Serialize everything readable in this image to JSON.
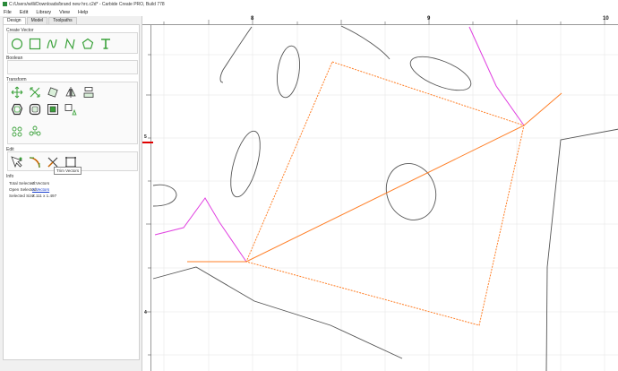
{
  "window": {
    "title": "C:/Users/willi/Downloads/brand new hrc.c2d* - Carbide Create PRO, Build 778"
  },
  "menu": [
    "File",
    "Edit",
    "Library",
    "View",
    "Help"
  ],
  "tabs": [
    "Design",
    "Model",
    "Toolpaths"
  ],
  "sections": {
    "create_vector": "Create Vector",
    "boolean": "Boolean",
    "transform": "Transform",
    "edit": "Edit",
    "info": "Info"
  },
  "tooltip": "Trim Vectors",
  "info": {
    "total_selected_label": "Total Selected:",
    "total_selected_value": "2 Vectors",
    "open_selected_label": "Open Selected:",
    "open_selected_value": "2 Vectors",
    "selected_size_label": "Selected Size:",
    "selected_size_value": "2.111 x 1.497"
  },
  "ruler": {
    "top_labels": [
      "8",
      "9",
      "10"
    ],
    "left_labels": [
      "5",
      "4"
    ]
  },
  "colors": {
    "accent": "#3aa13a",
    "selected": "#ff7f27",
    "magenta": "#e040e0",
    "curve": "#555555",
    "origin_marker": "#e00000"
  },
  "icons": {
    "create": [
      "circle-icon",
      "rectangle-icon",
      "curve-icon",
      "polyline-icon",
      "polygon-icon",
      "text-icon"
    ],
    "transform": [
      "move-icon",
      "scale-icon",
      "rotate-icon",
      "mirror-icon",
      "align-icon",
      "offset-icon",
      "group-icon",
      "join-icon",
      "nest-icon",
      "array-icon",
      "circular-array-icon"
    ],
    "edit": [
      "node-edit-icon",
      "fillet-icon",
      "trim-vectors-icon",
      "extend-icon"
    ]
  }
}
